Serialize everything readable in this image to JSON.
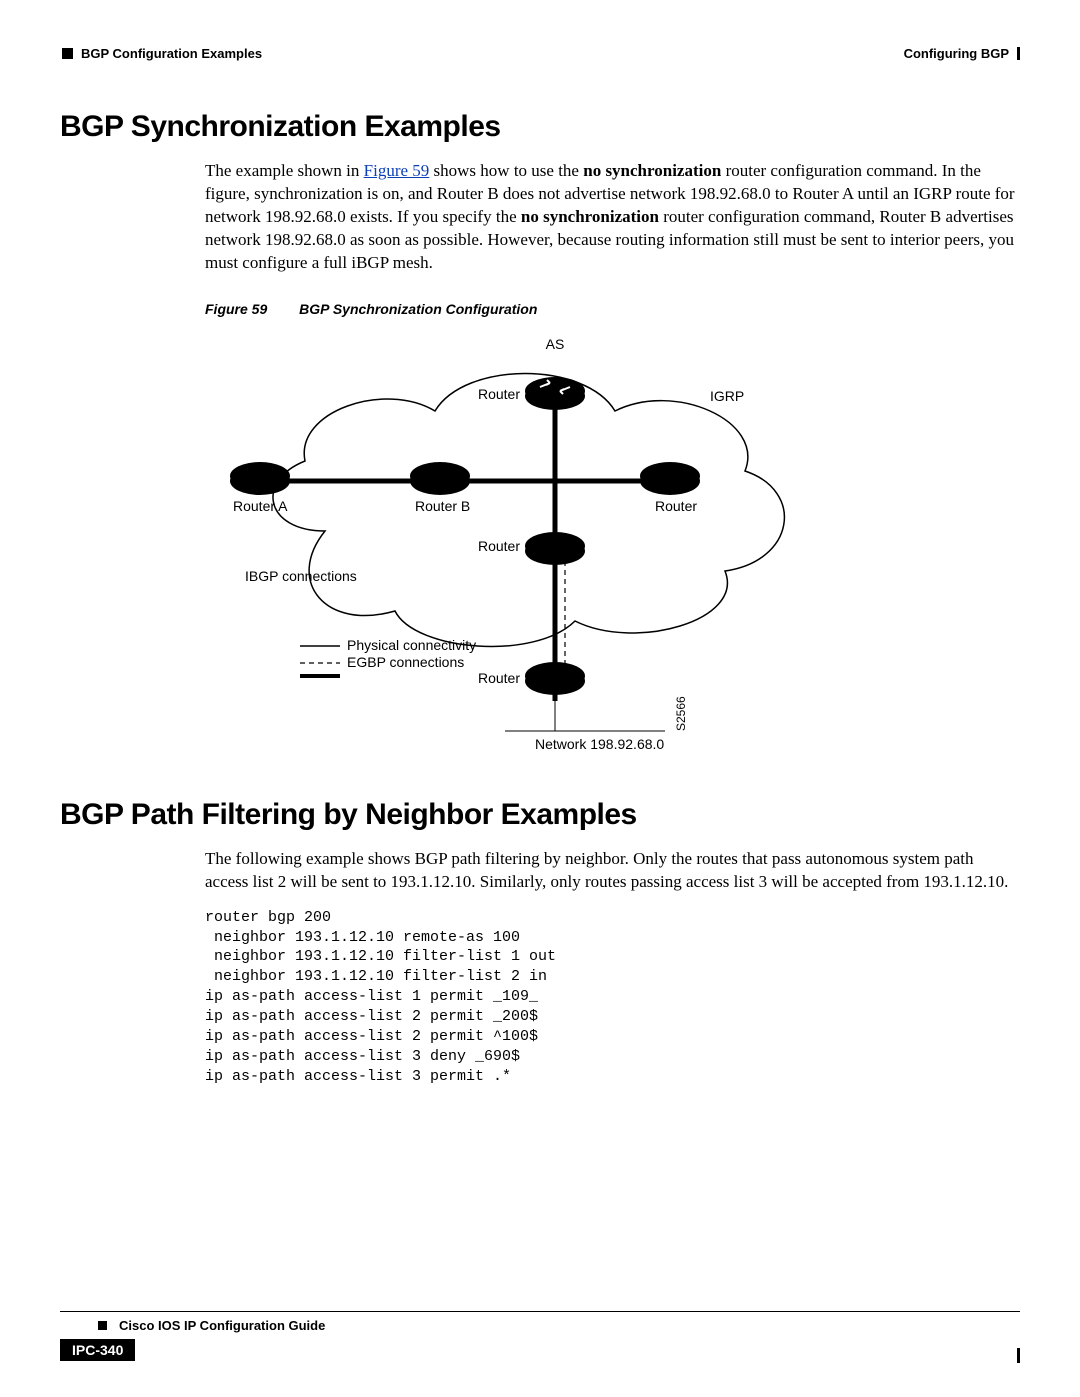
{
  "header": {
    "chapter": "Configuring BGP",
    "section": "BGP Configuration Examples"
  },
  "section1": {
    "title": "BGP Synchronization Examples",
    "para": {
      "t1": "The example shown in ",
      "link": "Figure 59",
      "t2": " shows how to use the ",
      "bold1": "no synchronization",
      "t3": " router configuration command. In the figure, synchronization is on, and Router B does not advertise network 198.92.68.0 to Router A until an IGRP route for network 198.92.68.0 exists. If you specify the ",
      "bold2": "no synchronization",
      "t4": " router configuration command, Router B advertises network 198.92.68.0 as soon as possible. However, because routing information still must be sent to interior peers, you must configure a full iBGP mesh."
    },
    "figure": {
      "num": "Figure 59",
      "title": "BGP Synchronization Configuration",
      "labels": {
        "as": "AS",
        "igrp": "IGRP",
        "router": "Router",
        "router_a": "Router A",
        "router_b": "Router B",
        "ibgp": "IBGP connections",
        "legend_phys": "Physical connectivity",
        "legend_egbp": "EGBP connections",
        "network": "Network 198.92.68.0",
        "sid": "S2566"
      }
    }
  },
  "section2": {
    "title": "BGP Path Filtering by Neighbor Examples",
    "para": "The following example shows BGP path filtering by neighbor. Only the routes that pass autonomous system path access list 2 will be sent to 193.1.12.10. Similarly, only routes passing access list 3 will be accepted from 193.1.12.10.",
    "code": "router bgp 200\n neighbor 193.1.12.10 remote-as 100\n neighbor 193.1.12.10 filter-list 1 out\n neighbor 193.1.12.10 filter-list 2 in\nip as-path access-list 1 permit _109_\nip as-path access-list 2 permit _200$\nip as-path access-list 2 permit ^100$\nip as-path access-list 3 deny _690$\nip as-path access-list 3 permit .*"
  },
  "footer": {
    "book": "Cisco IOS IP Configuration Guide",
    "page": "IPC-340"
  }
}
